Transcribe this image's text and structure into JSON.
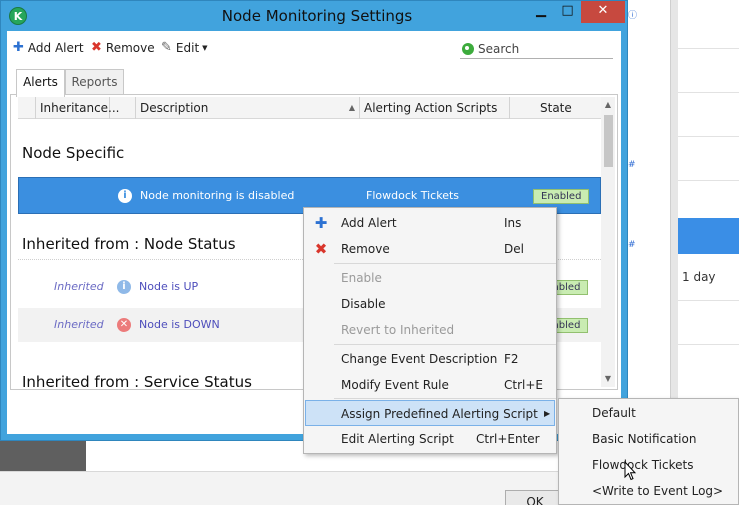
{
  "window": {
    "title": "Node Monitoring Settings",
    "controls": {
      "minimize": "▁",
      "maximize": "□",
      "close": "✕"
    }
  },
  "toolbar": {
    "add_alert": "Add Alert",
    "remove": "Remove",
    "edit": "Edit",
    "search_placeholder": "Search"
  },
  "tabs": [
    {
      "label": "Alerts",
      "active": true
    },
    {
      "label": "Reports",
      "active": false
    }
  ],
  "grid": {
    "columns": [
      "Inheritance...",
      "Description",
      "Alerting Action Scripts",
      "State"
    ],
    "groups": [
      {
        "title": "Node Specific",
        "rows": [
          {
            "inheritance": "",
            "description": "Node monitoring is disabled",
            "script": "Flowdock Tickets",
            "state": "Enabled",
            "icon": "info-icon"
          }
        ]
      },
      {
        "title": "Inherited from : Node Status",
        "rows": [
          {
            "inheritance": "Inherited",
            "description": "Node is UP",
            "script": "",
            "state": "Enabled",
            "icon": "info-icon"
          },
          {
            "inheritance": "Inherited",
            "description": "Node is DOWN",
            "script": "",
            "state": "Enabled",
            "icon": "error-icon"
          }
        ]
      },
      {
        "title": "Inherited from : Service Status",
        "rows": []
      }
    ]
  },
  "context_menu": {
    "items": [
      {
        "label": "Add Alert",
        "shortcut": "Ins",
        "icon": "plus-icon",
        "disabled": false
      },
      {
        "label": "Remove",
        "shortcut": "Del",
        "icon": "remove-icon",
        "disabled": false
      },
      {
        "label": "Enable",
        "shortcut": "",
        "disabled": true
      },
      {
        "label": "Disable",
        "shortcut": "",
        "disabled": false
      },
      {
        "label": "Revert to Inherited",
        "shortcut": "",
        "disabled": true
      },
      {
        "label": "Change Event Description",
        "shortcut": "F2",
        "disabled": false
      },
      {
        "label": "Modify Event Rule",
        "shortcut": "Ctrl+E",
        "disabled": false
      },
      {
        "label": "Assign Predefined Alerting Script",
        "shortcut": "",
        "disabled": false,
        "submenu": true
      },
      {
        "label": "Edit Alerting Script",
        "shortcut": "Ctrl+Enter",
        "disabled": false
      }
    ]
  },
  "submenu": {
    "items": [
      "Default",
      "Basic Notification",
      "Flowdock Tickets",
      "<Write to Event Log>"
    ]
  },
  "background": {
    "right_text": "1 day",
    "ok_button": "OK"
  },
  "colors": {
    "window_frame": "#41a3dd",
    "selection": "#3b8fe0",
    "badge": "#c9ecb2",
    "close_button": "#c7493f"
  }
}
